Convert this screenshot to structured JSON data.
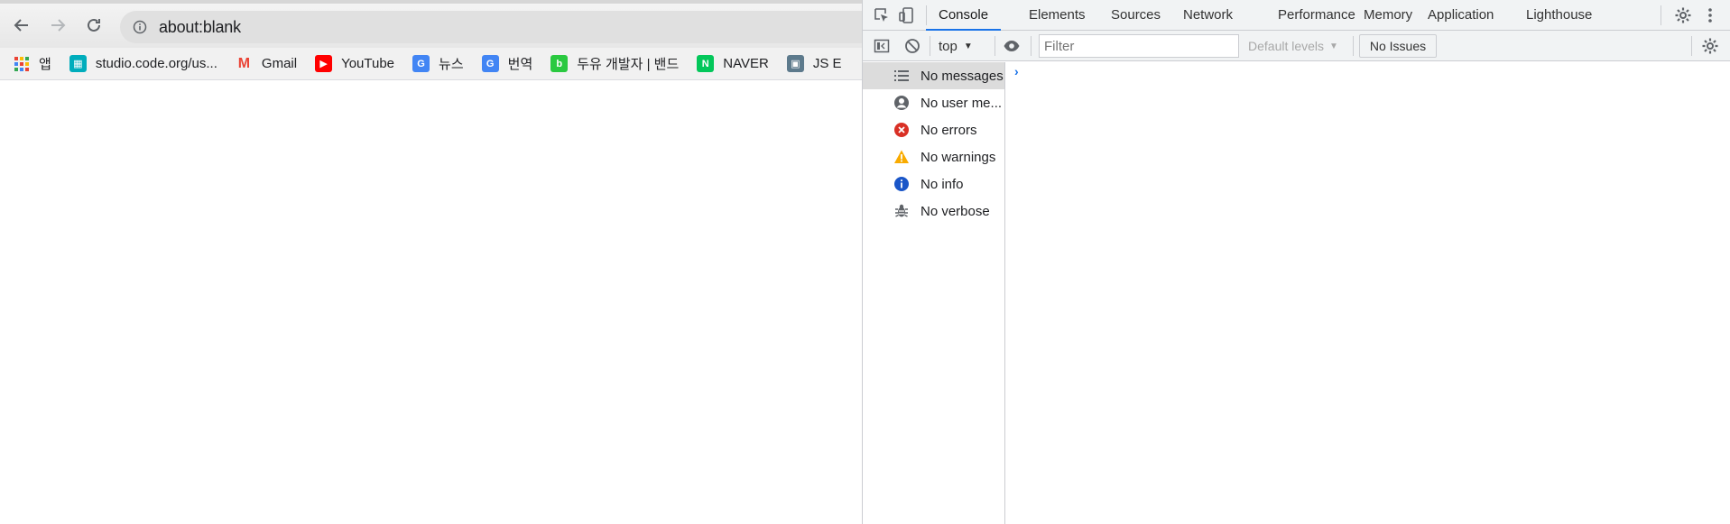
{
  "browser": {
    "url": "about:blank",
    "bookmarks": [
      {
        "label": "앱",
        "icon": "apps-icon",
        "color": "#ea4335"
      },
      {
        "label": "studio.code.org/us...",
        "icon": "code-org-icon",
        "color": "#00adbc"
      },
      {
        "label": "Gmail",
        "icon": "gmail-icon",
        "color": "#ea4335"
      },
      {
        "label": "YouTube",
        "icon": "youtube-icon",
        "color": "#ff0000"
      },
      {
        "label": "뉴스",
        "icon": "news-icon",
        "color": "#4285f4"
      },
      {
        "label": "번역",
        "icon": "translate-icon",
        "color": "#4285f4"
      },
      {
        "label": "두유 개발자 | 밴드",
        "icon": "band-icon",
        "color": "#2ac940"
      },
      {
        "label": "NAVER",
        "icon": "naver-icon",
        "color": "#03c75a"
      },
      {
        "label": "JS E",
        "icon": "js-icon",
        "color": "#5d7a8c"
      }
    ]
  },
  "devtools": {
    "tabs": [
      "Console",
      "Elements",
      "Sources",
      "Network",
      "Performance",
      "Memory",
      "Application",
      "Lighthouse"
    ],
    "active_tab": "Console",
    "context": "top",
    "filter_placeholder": "Filter",
    "levels": "Default levels",
    "issues": "No Issues",
    "sidebar": [
      {
        "label": "No messages",
        "icon": "list-icon"
      },
      {
        "label": "No user me...",
        "icon": "user-icon"
      },
      {
        "label": "No errors",
        "icon": "error-icon"
      },
      {
        "label": "No warnings",
        "icon": "warning-icon"
      },
      {
        "label": "No info",
        "icon": "info-icon"
      },
      {
        "label": "No verbose",
        "icon": "bug-icon"
      }
    ],
    "prompt": "›",
    "colors": {
      "accent": "#1a73e8",
      "error": "#d93025",
      "warning": "#f9ab00",
      "info": "#1a56c8"
    }
  }
}
